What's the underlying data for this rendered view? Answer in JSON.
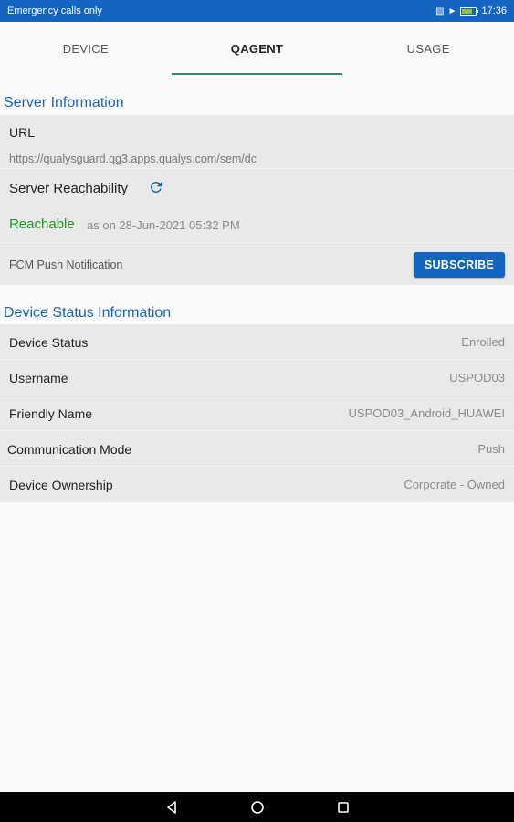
{
  "status_bar": {
    "carrier": "Emergency calls only",
    "time": "17:36",
    "icons": [
      "vibrate-icon",
      "wifi-icon",
      "battery-icon"
    ]
  },
  "tabs": [
    {
      "label": "DEVICE",
      "active": false
    },
    {
      "label": "QAGENT",
      "active": true
    },
    {
      "label": "USAGE",
      "active": false
    }
  ],
  "server_info": {
    "title": "Server Information",
    "url_label": "URL",
    "url_value": "https://qualysguard.qg3.apps.qualys.com/sem/dc",
    "reachability_label": "Server Reachability",
    "reachability_status": "Reachable",
    "reachability_time": "as on 28-Jun-2021 05:32 PM",
    "fcm_label": "FCM Push Notification",
    "subscribe_label": "SUBSCRIBE"
  },
  "device_status": {
    "title": "Device Status Information",
    "rows": [
      {
        "label": "Device Status",
        "value": "Enrolled"
      },
      {
        "label": "Username",
        "value": "USPOD03"
      },
      {
        "label": "Friendly Name",
        "value": "USPOD03_Android_HUAWEI"
      },
      {
        "label": "Communication Mode",
        "value": "Push"
      },
      {
        "label": "Device Ownership",
        "value": "Corporate - Owned"
      }
    ]
  },
  "colors": {
    "accent": "#1565c0",
    "tab_indicator": "#2e8b6e",
    "reachable": "#1b9a1b",
    "panel_bg": "#e9e9e9"
  }
}
